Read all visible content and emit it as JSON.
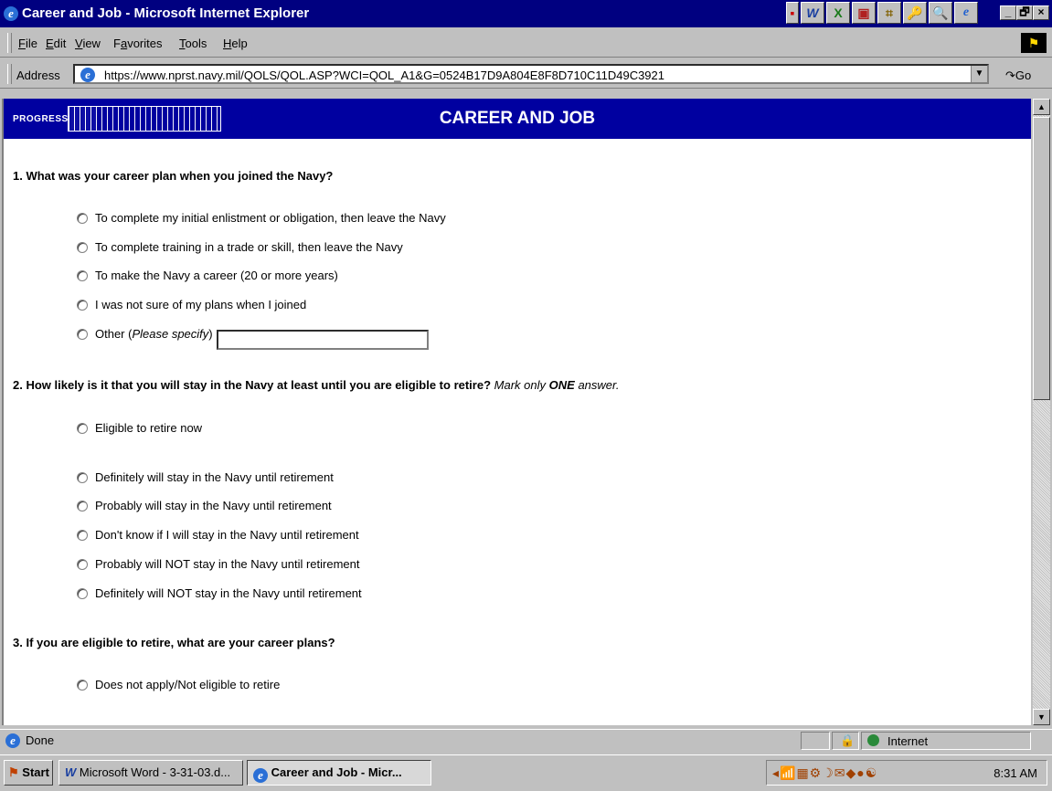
{
  "window": {
    "title": "Career and Job - Microsoft Internet Explorer",
    "controls": [
      "_",
      "🗗",
      "×"
    ]
  },
  "menubar": {
    "items": [
      {
        "label": "File",
        "accel": "F",
        "rest": "ile"
      },
      {
        "label": "Edit",
        "accel": "E",
        "rest": "dit"
      },
      {
        "label": "View",
        "accel": "V",
        "rest": "iew"
      },
      {
        "label": "Favorites",
        "accel": "a",
        "pre": "F",
        "rest": "vorites"
      },
      {
        "label": "Tools",
        "accel": "T",
        "rest": "ools"
      },
      {
        "label": "Help",
        "accel": "H",
        "rest": "elp"
      }
    ]
  },
  "address": {
    "label": "Address",
    "url": "https://www.nprst.navy.mil/QOLS/QOL.ASP?WCI=QOL_A1&G=0524B17D9A804E8F8D710C11D49C3921",
    "go_label": "Go"
  },
  "page": {
    "progress_label": "PROGRESS:",
    "progress_fraction": 0.18,
    "title": "CAREER AND JOB",
    "questions": [
      {
        "text": "1. What was your career plan when you joined the Navy?",
        "options": [
          "To complete my initial enlistment or obligation, then leave the Navy",
          "To complete training in a trade or skill, then leave the Navy",
          "To make the Navy a career (20 or more years)",
          "I was not sure of my plans when I joined"
        ],
        "other_prefix": "Other (",
        "other_italic": "Please specify",
        "other_suffix": ")",
        "other_value": ""
      },
      {
        "text": "2. How likely is it that you will stay in the Navy at least until you are eligible to retire?",
        "instr_pre": "Mark only",
        "instr_bold": "ONE",
        "instr_post": "answer.",
        "options": [
          "Eligible to retire now",
          "Definitely will stay in the Navy until retirement",
          "Probably will stay in the Navy until retirement",
          "Don't know if I will stay in the Navy until retirement",
          "Probably will NOT stay in the Navy until retirement",
          "Definitely will NOT stay in the Navy until retirement"
        ]
      },
      {
        "text": "3. If you are eligible to retire, what are your career plans?",
        "options": [
          "Does not apply/Not eligible to retire"
        ]
      }
    ]
  },
  "statusbar": {
    "status": "Done",
    "zone": "Internet"
  },
  "taskbar": {
    "start": "Start",
    "tasks": [
      "Microsoft Word - 3-31-03.d...",
      "Career and Job - Micr..."
    ],
    "clock": "8:31 AM"
  }
}
